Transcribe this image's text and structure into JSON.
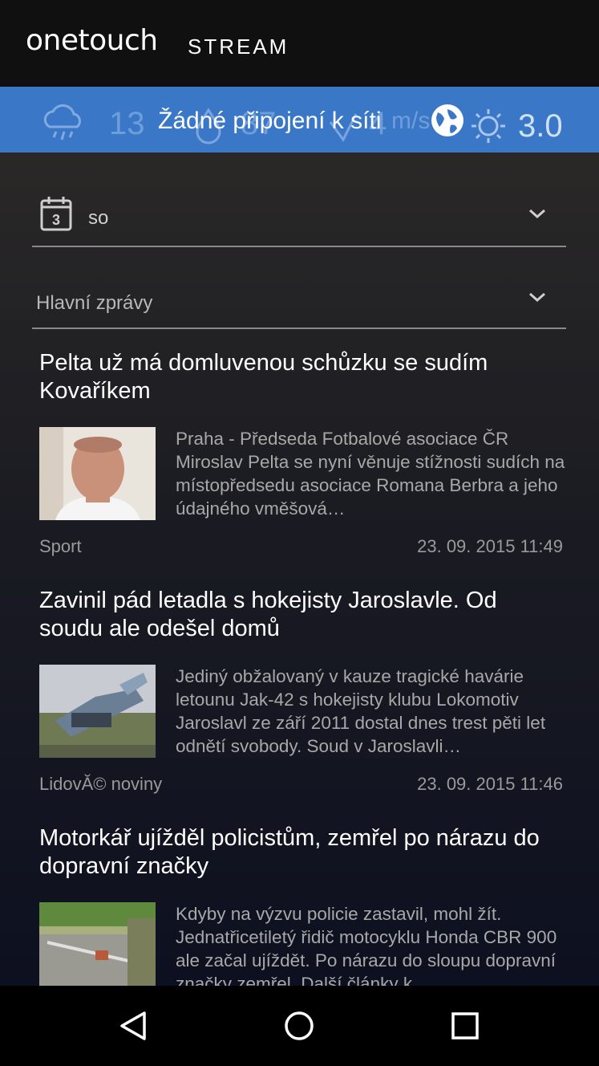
{
  "header": {
    "logo_main": "onetouch",
    "logo_sub": "STREAM"
  },
  "weather": {
    "temperature": "13",
    "humidity": "87",
    "wind": "4",
    "wind_unit": "m/s",
    "uv_index": "3.0",
    "no_connection": "Žádné připojení k síti",
    "icons": [
      "rain-cloud-icon",
      "drop-icon",
      "wind-icon",
      "globe-icon",
      "sun-icon"
    ]
  },
  "filters": {
    "date_value": "so",
    "calendar_day": "3",
    "category_value": "Hlavní zprávy"
  },
  "articles": [
    {
      "title": "Pelta už má domluvenou schůzku se sudím Kovaříkem",
      "summary": "Praha - Předseda Fotbalové asociace ČR Miroslav Pelta se nyní věnuje stížnosti sudích na místopředsedu asociace Romana Berbra a jeho údajného vměšová…",
      "source": "Sport",
      "date": "23. 09. 2015 11:49"
    },
    {
      "title": "Zavinil pád letadla s hokejisty Jaroslavle. Od soudu ale odešel domů",
      "summary": "Jediný obžalovaný v kauze tragické havárie letounu Jak-42 s hokejisty klubu Lokomotiv Jaroslavl ze září 2011 dostal dnes trest pěti let odnětí svobody. Soud v Jaroslavli…",
      "source": "LidovĂ© noviny",
      "date": "23. 09. 2015 11:46"
    },
    {
      "title": "Motorkář ujížděl policistům, zemřel po nárazu do dopravní značky",
      "summary": "Kdyby na výzvu policie zastavil, mohl žít. Jednatřicetiletý řidič motocyklu Honda CBR 900 ale začal ujíždět. Po nárazu do sloupu dopravní značky zemřel. Další články k…",
      "source": "",
      "date": ""
    }
  ],
  "colors": {
    "weather_bar": "#3a78c7",
    "header_bg": "#101010",
    "nav_bg": "#000000"
  }
}
